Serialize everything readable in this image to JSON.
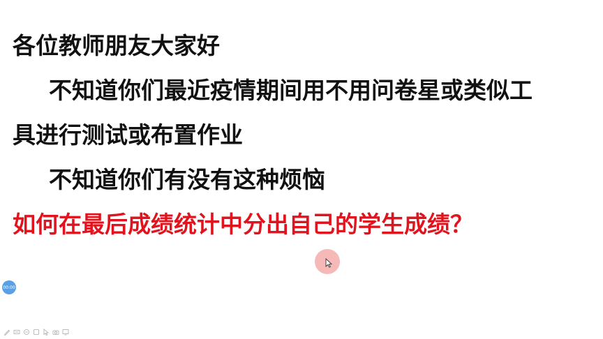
{
  "slide": {
    "lines": [
      "各位教师朋友大家好",
      "不知道你们最近疫情期间用不用问卷星或类似工",
      "具进行测试或布置作业",
      "不知道你们有没有这种烦恼",
      "如何在最后成绩统计中分出自己的学生成绩？"
    ],
    "highlight_color": "#e0141e",
    "text_color": "#111111"
  },
  "recorder": {
    "timer": "00:00",
    "toolbar_icons": [
      "pen-icon",
      "highlighter-icon",
      "eraser-icon",
      "shape-icon",
      "pointer-icon",
      "camera-icon",
      "screen-icon"
    ]
  }
}
